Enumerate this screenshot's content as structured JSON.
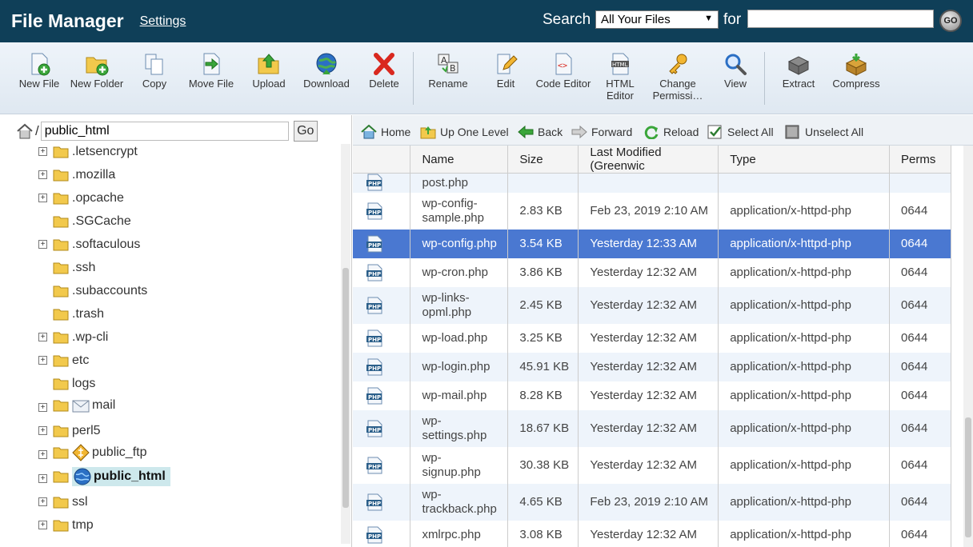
{
  "header": {
    "title": "File Manager",
    "settings": "Settings",
    "search_label": "Search",
    "scope_selected": "All Your Files",
    "for_label": "for",
    "search_value": "",
    "go": "GO"
  },
  "toolbar": {
    "new_file": "New File",
    "new_folder": "New Folder",
    "copy": "Copy",
    "move_file": "Move File",
    "upload": "Upload",
    "download": "Download",
    "delete": "Delete",
    "rename": "Rename",
    "edit": "Edit",
    "code_editor": "Code Editor",
    "html_editor": "HTML Editor",
    "change_permissions": "Change Permissi…",
    "view": "View",
    "extract": "Extract",
    "compress": "Compress"
  },
  "left": {
    "slash": "/",
    "path_value": "public_html",
    "go": "Go",
    "tree": [
      ".letsencrypt",
      ".mozilla",
      ".opcache",
      ".SGCache",
      ".softaculous",
      ".ssh",
      ".subaccounts",
      ".trash",
      ".wp-cli",
      "etc",
      "logs",
      "mail",
      "perl5",
      "public_ftp",
      "public_html",
      "ssl",
      "tmp"
    ]
  },
  "nav": {
    "home": "Home",
    "up": "Up One Level",
    "back": "Back",
    "forward": "Forward",
    "reload": "Reload",
    "select_all": "Select All",
    "unselect_all": "Unselect All"
  },
  "table": {
    "columns": [
      "Name",
      "Size",
      "Last Modified (Greenwic",
      "Type",
      "Perms"
    ],
    "rows": [
      {
        "name": "post.php",
        "size": "",
        "modified": "",
        "type": "",
        "perms": ""
      },
      {
        "name": "wp-config-\nsample.php",
        "size": "2.83 KB",
        "modified": "Feb 23, 2019 2:10 AM",
        "type": "application/x-httpd-php",
        "perms": "0644"
      },
      {
        "name": "wp-config.php",
        "size": "3.54 KB",
        "modified": "Yesterday 12:33 AM",
        "type": "application/x-httpd-php",
        "perms": "0644"
      },
      {
        "name": "wp-cron.php",
        "size": "3.86 KB",
        "modified": "Yesterday 12:32 AM",
        "type": "application/x-httpd-php",
        "perms": "0644"
      },
      {
        "name": "wp-links-\nopml.php",
        "size": "2.45 KB",
        "modified": "Yesterday 12:32 AM",
        "type": "application/x-httpd-php",
        "perms": "0644"
      },
      {
        "name": "wp-load.php",
        "size": "3.25 KB",
        "modified": "Yesterday 12:32 AM",
        "type": "application/x-httpd-php",
        "perms": "0644"
      },
      {
        "name": "wp-login.php",
        "size": "45.91 KB",
        "modified": "Yesterday 12:32 AM",
        "type": "application/x-httpd-php",
        "perms": "0644"
      },
      {
        "name": "wp-mail.php",
        "size": "8.28 KB",
        "modified": "Yesterday 12:32 AM",
        "type": "application/x-httpd-php",
        "perms": "0644"
      },
      {
        "name": "wp-\nsettings.php",
        "size": "18.67 KB",
        "modified": "Yesterday 12:32 AM",
        "type": "application/x-httpd-php",
        "perms": "0644"
      },
      {
        "name": "wp-\nsignup.php",
        "size": "30.38 KB",
        "modified": "Yesterday 12:32 AM",
        "type": "application/x-httpd-php",
        "perms": "0644"
      },
      {
        "name": "wp-\ntrackback.php",
        "size": "4.65 KB",
        "modified": "Feb 23, 2019 2:10 AM",
        "type": "application/x-httpd-php",
        "perms": "0644"
      },
      {
        "name": "xmlrpc.php",
        "size": "3.08 KB",
        "modified": "Yesterday 12:32 AM",
        "type": "application/x-httpd-php",
        "perms": "0644"
      }
    ]
  },
  "colors": {
    "header_bg": "#0f3f58",
    "selected_row": "#4a78d1",
    "alt_row": "#eef4fb",
    "selected_tree": "#cde8ec"
  }
}
